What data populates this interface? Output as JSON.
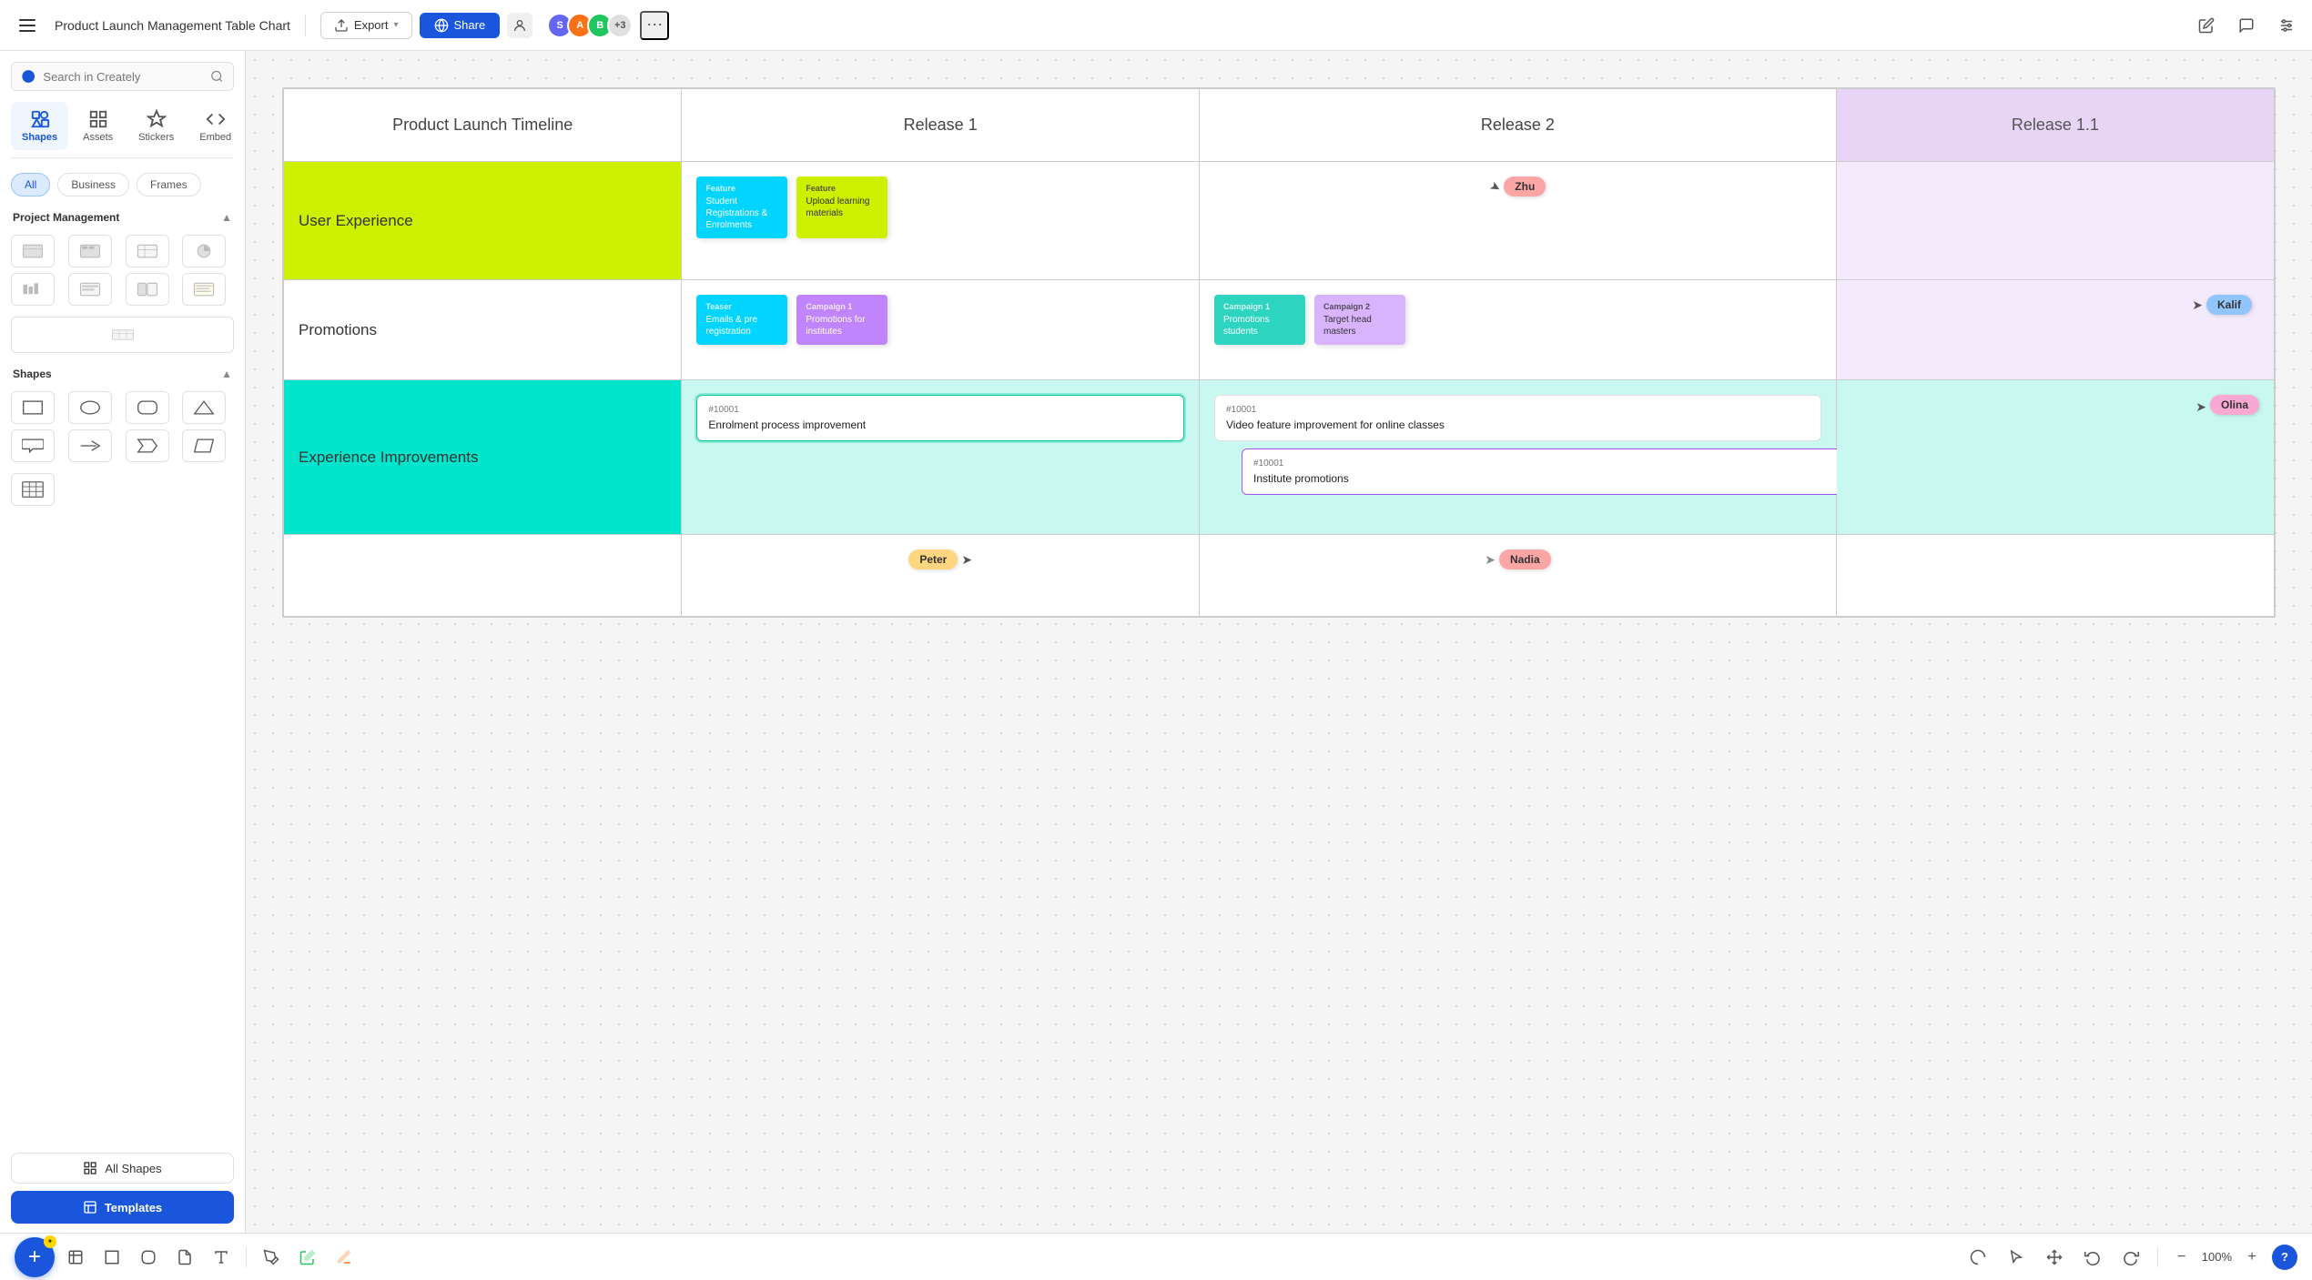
{
  "topbar": {
    "menu_label": "Menu",
    "doc_title": "Product Launch Management Table Chart",
    "export_label": "Export",
    "share_label": "Share",
    "avatars": [
      {
        "initials": "S",
        "color": "#6366f1"
      },
      {
        "initials": "A",
        "color": "#f97316"
      },
      {
        "initials": "B",
        "color": "#22c55e"
      },
      {
        "count": "+3"
      }
    ]
  },
  "sidebar": {
    "search_placeholder": "Search in Creately",
    "nav_items": [
      {
        "label": "Shapes",
        "active": true
      },
      {
        "label": "Assets"
      },
      {
        "label": "Stickers"
      },
      {
        "label": "Embed"
      }
    ],
    "filter_buttons": [
      {
        "label": "All",
        "active": true
      },
      {
        "label": "Business"
      },
      {
        "label": "Frames"
      }
    ],
    "sections": [
      {
        "label": "Project Management"
      },
      {
        "label": "Shapes"
      }
    ],
    "all_shapes_label": "All Shapes",
    "templates_label": "Templates"
  },
  "table": {
    "headers": [
      {
        "label": "Product Launch Timeline"
      },
      {
        "label": "Release 1"
      },
      {
        "label": "Release 2"
      },
      {
        "label": "Release 1.1"
      }
    ],
    "rows": [
      {
        "label": "User Experience",
        "label_style": "ux",
        "cells": [
          {
            "col": "release1",
            "stickies": [
              {
                "type": "cyan",
                "tag": "Feature",
                "text": "Student Registrations & Enrolments"
              },
              {
                "type": "lime",
                "tag": "Feature",
                "text": "Upload learning materials"
              }
            ]
          },
          {
            "col": "release2",
            "user_bubble": {
              "name": "Zhu",
              "color": "pink",
              "has_cursor": true
            }
          },
          {
            "col": "release11",
            "empty": true
          }
        ]
      },
      {
        "label": "Promotions",
        "label_style": "promotions",
        "cells": [
          {
            "col": "release1",
            "stickies": [
              {
                "type": "cyan",
                "tag": "Teaser",
                "text": "Emails & pre registration"
              },
              {
                "type": "purple",
                "tag": "Campaign 1",
                "text": "Promotions for institutes"
              }
            ]
          },
          {
            "col": "release2",
            "stickies": [
              {
                "type": "teal",
                "tag": "Campaign 1",
                "text": "Promotions students"
              },
              {
                "type": "purple_light",
                "tag": "Campaign 2",
                "text": "Target head masters"
              }
            ]
          },
          {
            "col": "release11",
            "user_bubble": {
              "name": "Kalif",
              "color": "blue",
              "has_cursor": true
            }
          }
        ]
      },
      {
        "label": "Experience Improvements",
        "label_style": "experience",
        "cells": [
          {
            "col": "release1",
            "ticket": {
              "id": "#10001",
              "title": "Enrolment process improvement",
              "selected": true
            }
          },
          {
            "col": "release2",
            "tickets": [
              {
                "id": "#10001",
                "title": "Video feature improvement for online classes",
                "selected": false
              },
              {
                "id": "#10001",
                "title": "Institute promotions",
                "selected": false,
                "purple": true
              }
            ]
          },
          {
            "col": "release11",
            "user_bubble": {
              "name": "Olina",
              "color": "pink",
              "has_cursor": true
            }
          }
        ]
      },
      {
        "label": "",
        "label_style": "bottom",
        "cells": [
          {
            "col": "release1",
            "user_bubble": {
              "name": "Peter",
              "color": "orange",
              "has_cursor": true
            }
          },
          {
            "col": "release2",
            "user_bubble": {
              "name": "Nadia",
              "color": "pink",
              "has_cursor": true
            }
          },
          {
            "col": "release11",
            "empty": true
          }
        ]
      }
    ]
  },
  "toolbar": {
    "zoom_level": "100%",
    "tools": [
      "frame",
      "rectangle",
      "rounded-rect",
      "text",
      "pen",
      "marker",
      "highlighter"
    ]
  }
}
